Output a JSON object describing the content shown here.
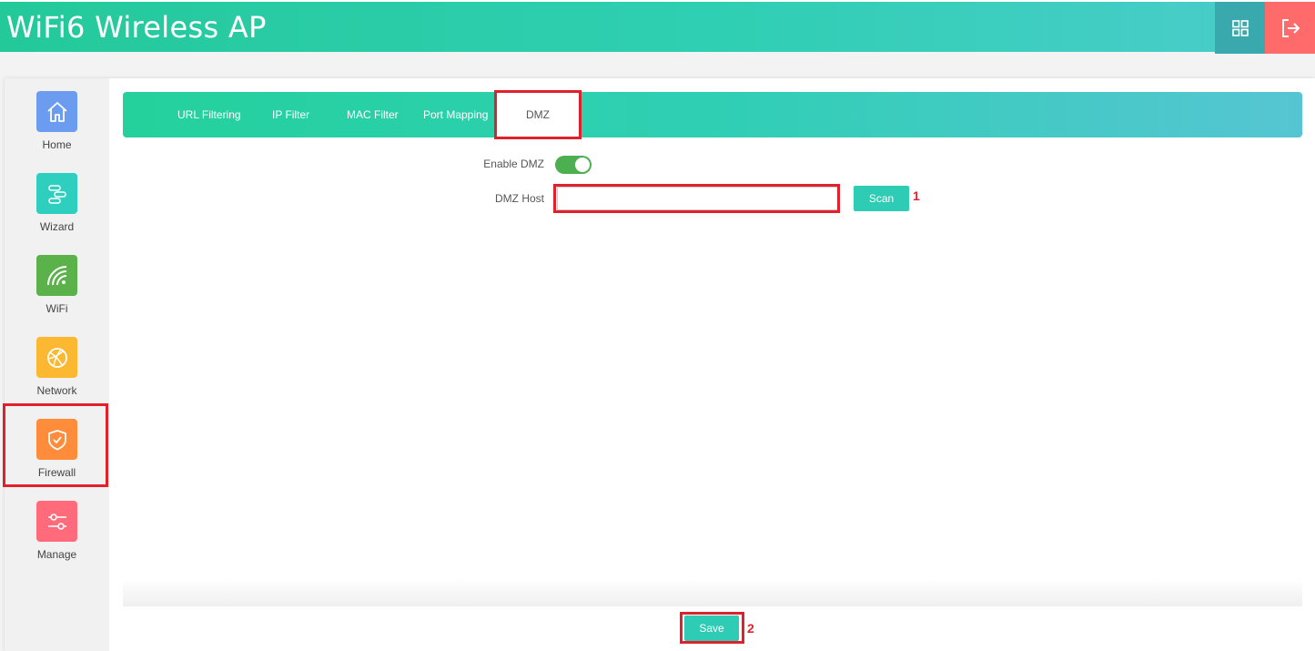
{
  "header": {
    "title": "WiFi6 Wireless AP",
    "apps_icon": "grid-icon",
    "logout_icon": "logout-icon"
  },
  "sidebar": {
    "items": [
      {
        "label": "Home",
        "icon": "home-icon",
        "color": "#6c9cf0"
      },
      {
        "label": "Wizard",
        "icon": "wizard-icon",
        "color": "#2fcfc0"
      },
      {
        "label": "WiFi",
        "icon": "wifi-icon",
        "color": "#5bb14a"
      },
      {
        "label": "Network",
        "icon": "globe-icon",
        "color": "#fbb830"
      },
      {
        "label": "Firewall",
        "icon": "shield-icon",
        "color": "#ff8c3b"
      },
      {
        "label": "Manage",
        "icon": "sliders-icon",
        "color": "#ff6b7a"
      }
    ]
  },
  "tabs": [
    {
      "label": "URL Filtering"
    },
    {
      "label": "IP Filter"
    },
    {
      "label": "MAC Filter"
    },
    {
      "label": "Port Mapping"
    },
    {
      "label": "DMZ"
    }
  ],
  "form": {
    "enable_label": "Enable DMZ",
    "enable_state": true,
    "host_label": "DMZ Host",
    "host_value": "",
    "scan_label": "Scan",
    "save_label": "Save"
  },
  "annotations": {
    "marker_1": "1",
    "marker_2": "2"
  },
  "colors": {
    "accent": "#2ecbb5",
    "highlight": "#e0202a",
    "toggle_on": "#4caf50"
  }
}
